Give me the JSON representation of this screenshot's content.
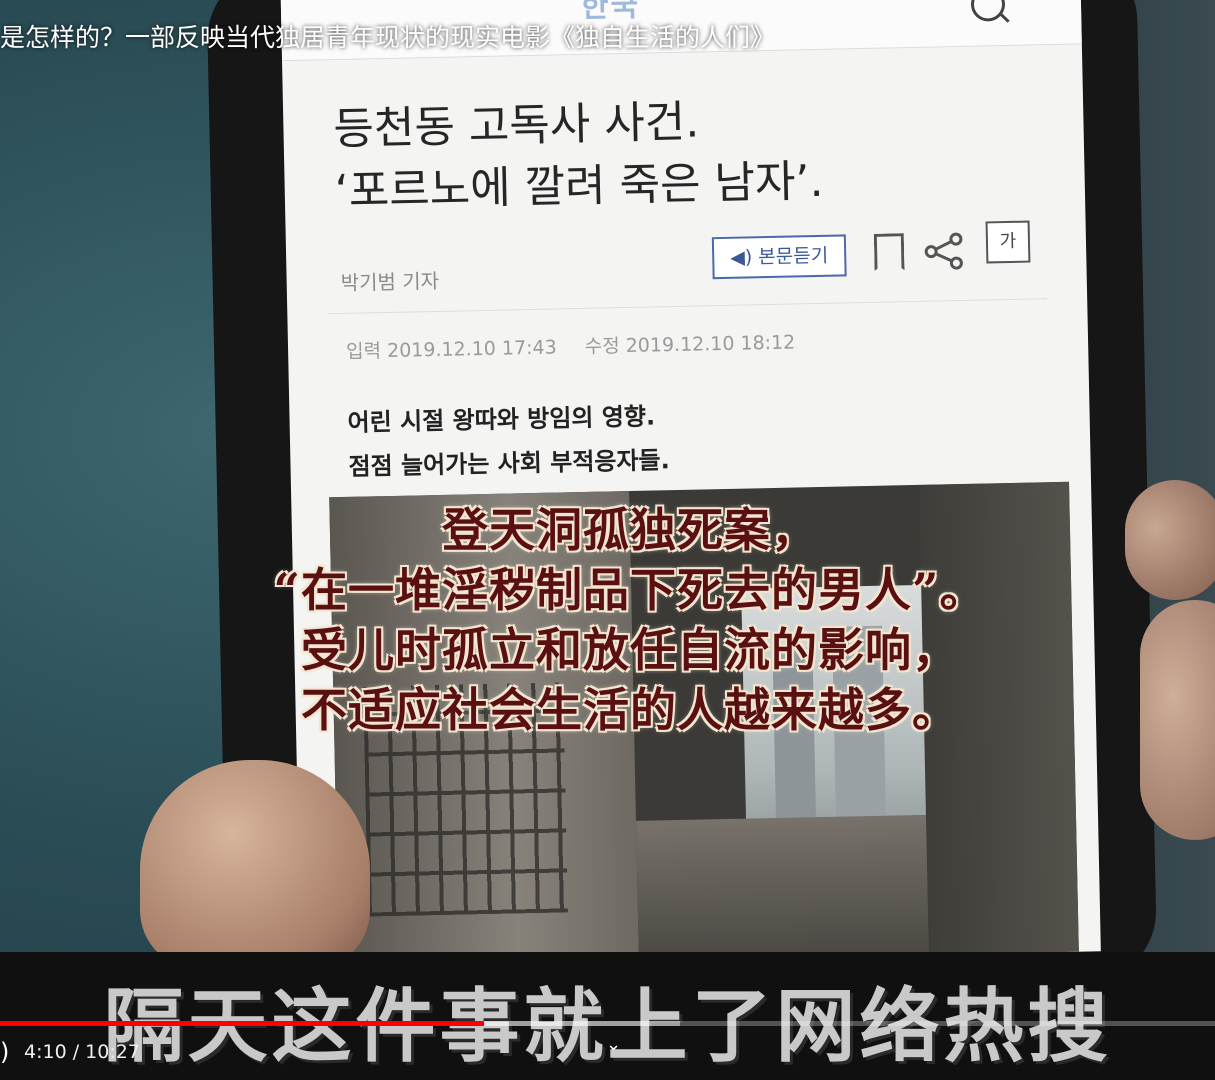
{
  "video": {
    "title": "是怎样的？一部反映当代独居青年现状的现实电影《独自生活的人们》"
  },
  "article": {
    "logo_text": "한국",
    "headline_line1": "등천동 고독사 사건.",
    "headline_line2": "‘포르노에 깔려 죽은 남자’.",
    "reporter": "박기범 기자",
    "listen_button": "◀) 본문듣기",
    "font_button": "가",
    "input_date": "입력 2019.12.10 17:43",
    "edit_date": "수정 2019.12.10 18:12",
    "summary_line1": "어린 시절 왕따와 방임의 영향.",
    "summary_line2": "점점 늘어가는 사회 부적응자들."
  },
  "subtitles": {
    "line1": "登天洞孤独死案，",
    "line2": "“在一堆淫秽制品下死去的男人”。",
    "line3": "受儿时孤立和放任自流的影响，",
    "line4": "不适应社会生活的人越来越多。",
    "bottom": "隔天这件事就上了网络热搜"
  },
  "player": {
    "time_display": "4:10 / 10:27",
    "current_seconds": 250,
    "duration_seconds": 627,
    "buffered_fraction": 0.56,
    "progress_color": "#ff0000"
  },
  "icons": {
    "search": "search-icon",
    "bookmark": "bookmark-icon",
    "share": "share-icon",
    "volume": "volume-icon",
    "chevron": "chevron-down-icon"
  }
}
